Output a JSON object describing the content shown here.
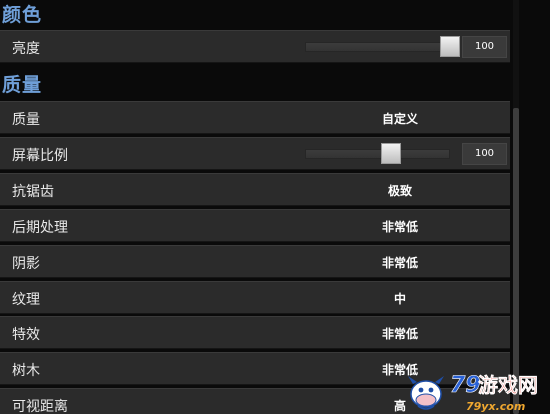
{
  "sections": {
    "color": {
      "title": "颜色"
    },
    "quality": {
      "title": "质量"
    }
  },
  "settings": {
    "brightness": {
      "label": "亮度",
      "value": "100",
      "level": 1.0
    },
    "quality_preset": {
      "label": "质量",
      "value": "自定义"
    },
    "screen_scale": {
      "label": "屏幕比例",
      "value": "100",
      "level": 0.6
    },
    "antialiasing": {
      "label": "抗锯齿",
      "value": "极致"
    },
    "post_processing": {
      "label": "后期处理",
      "value": "非常低"
    },
    "shadows": {
      "label": "阴影",
      "value": "非常低"
    },
    "textures": {
      "label": "纹理",
      "value": "中"
    },
    "effects": {
      "label": "特效",
      "value": "非常低"
    },
    "foliage": {
      "label": "树木",
      "value": "非常低"
    },
    "view_distance": {
      "label": "可视距离",
      "value": "高"
    }
  },
  "watermark": {
    "text": "79游戏网",
    "url_text": "79yx.com",
    "icon": "cow-mascot-logo"
  },
  "colors": {
    "section_header": "#6f9fd8",
    "row_background": "#2b2b2b",
    "page_background": "#0a0a0a"
  }
}
